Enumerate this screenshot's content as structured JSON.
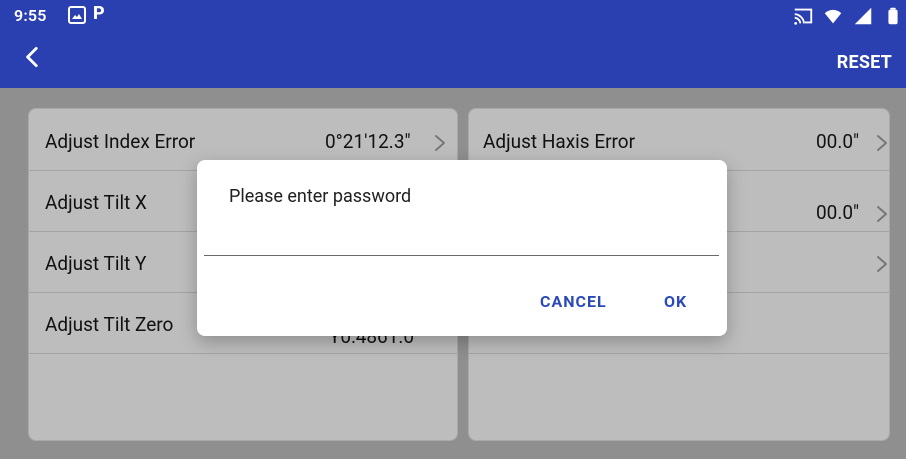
{
  "statusbar": {
    "time": "9:55",
    "left_icons": [
      "photos-icon",
      "p-icon"
    ],
    "right_icons": [
      "cast-icon",
      "wifi-icon",
      "signal-icon",
      "battery-icon"
    ]
  },
  "appbar": {
    "back_icon": "chevron-left-icon",
    "reset_label": "RESET",
    "colors": {
      "appbar": "#2a3fb0",
      "accent": "#2a4ab8"
    }
  },
  "left_panel": {
    "rows": [
      {
        "label": "Adjust Index Error",
        "value": "0°21'12.3\""
      },
      {
        "label": "Adjust Tilt X",
        "value": ""
      },
      {
        "label": "Adjust Tilt Y",
        "value": ""
      },
      {
        "label": "Adjust Tilt Zero",
        "value": "Y0:4861.0"
      }
    ]
  },
  "right_panel": {
    "rows": [
      {
        "label": "Adjust Haxis Error",
        "value": "00.0\""
      },
      {
        "label": "",
        "value": "00.0\""
      },
      {
        "label": "",
        "value": ""
      },
      {
        "label": "",
        "value": ""
      }
    ]
  },
  "dialog": {
    "title": "Please enter password",
    "input_value": "",
    "cancel_label": "CANCEL",
    "ok_label": "OK"
  }
}
